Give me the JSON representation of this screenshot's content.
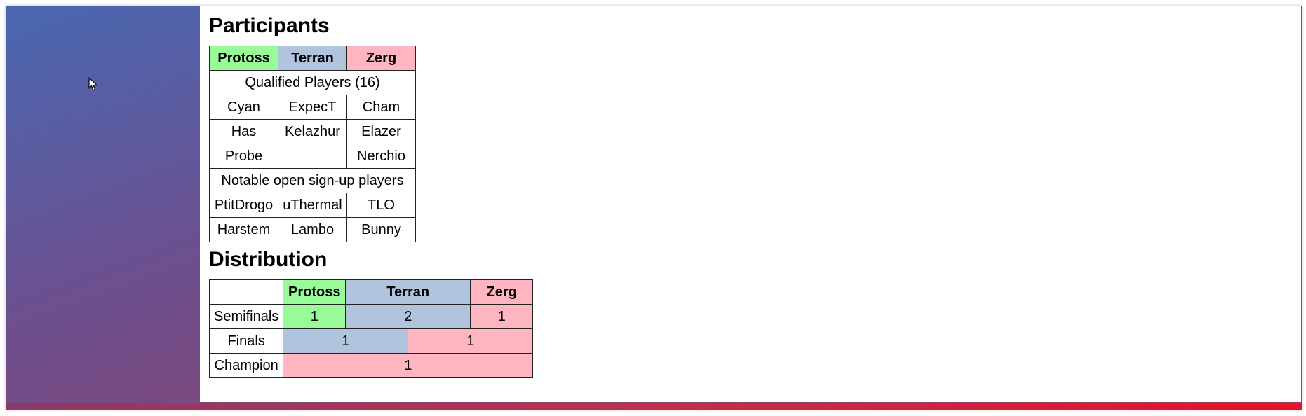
{
  "participants": {
    "heading": "Participants",
    "races": {
      "protoss": "Protoss",
      "terran": "Terran",
      "zerg": "Zerg"
    },
    "qualified_label": "Qualified Players (16)",
    "qualified_rows": [
      [
        "Cyan",
        "ExpecT",
        "Cham"
      ],
      [
        "Has",
        "Kelazhur",
        "Elazer"
      ],
      [
        "Probe",
        "",
        "Nerchio"
      ]
    ],
    "open_label": "Notable open sign-up players",
    "open_rows": [
      [
        "PtitDrogo",
        "uThermal",
        "TLO"
      ],
      [
        "Harstem",
        "Lambo",
        "Bunny"
      ]
    ]
  },
  "distribution": {
    "heading": "Distribution",
    "races": {
      "protoss": "Protoss",
      "terran": "Terran",
      "zerg": "Zerg"
    },
    "semifinals": {
      "label": "Semifinals",
      "protoss": "1",
      "terran": "2",
      "zerg": "1"
    },
    "finals": {
      "label": "Finals",
      "terran": "1",
      "zerg": "1"
    },
    "champion": {
      "label": "Champion",
      "zerg": "1"
    }
  },
  "colors": {
    "protoss": "#98fb98",
    "terran": "#b0c4de",
    "zerg": "#ffb6c1",
    "gradient_start": "#4a68b2",
    "gradient_end": "#e8102a"
  },
  "icons": {
    "cursor": "mouse-pointer-icon"
  }
}
